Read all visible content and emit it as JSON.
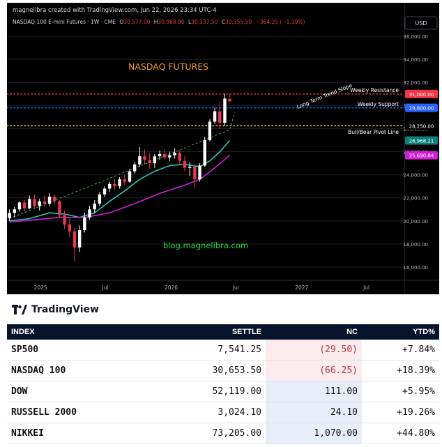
{
  "header": {
    "credit": "magnelibra created with TradingView.com, Jun 22, 2026 23:34 UTC-4",
    "symbol_line": "NASDAQ 100 E-mini Futures · 1W · CME",
    "ohlc": [
      {
        "k": "O",
        "v": "30,577.00"
      },
      {
        "k": "H",
        "v": "30,968.00"
      },
      {
        "k": "L",
        "v": "30,337.50"
      },
      {
        "k": "C",
        "v": "30,355.50"
      }
    ],
    "change": "−364.25 (−1.19%)",
    "currency": "USD"
  },
  "annotations": {
    "title": "NASDAQ FUTURES",
    "watermark": "blog.magnelibra.com",
    "resistance": "Weekly Resistance",
    "support": "Weekly Support",
    "pivot": "Bull/Bear Pivot Line",
    "trend": "Long Term Trend Slope"
  },
  "branding": {
    "name": "TradingView"
  },
  "chart_data": {
    "type": "candlestick",
    "y_ticks": [
      16000,
      18000,
      20000,
      22000,
      24000,
      26000,
      28000,
      30000,
      32000,
      34000,
      36000
    ],
    "y_tick_labels": [
      "16,000.00",
      "18,000.00",
      "20,000.00",
      "22,000.00",
      "24,000.00",
      "26,000.00",
      "28,000.00",
      "30,000.00",
      "32,000.00",
      "34,000.00",
      "36,000.00"
    ],
    "x_labels": [
      {
        "label": "2025",
        "date": "2025-01-01"
      },
      {
        "label": "Jul",
        "date": "2025-07-01"
      },
      {
        "label": "2026",
        "date": "2026-01-01"
      },
      {
        "label": "Jul",
        "date": "2026-07-01"
      },
      {
        "label": "2027",
        "date": "2027-01-01"
      },
      {
        "label": "Jul",
        "date": "2027-07-01"
      }
    ],
    "levels": [
      {
        "value": 31000,
        "label": "31,000.00",
        "color": "#f23645",
        "name": "resistance"
      },
      {
        "value": 29800,
        "label": "29,800.00",
        "color": "#2962ff",
        "name": "support"
      },
      {
        "value": 28250,
        "label": "28,250.00",
        "color": "#e0c21a",
        "name": "pivot"
      }
    ],
    "ma_labels": [
      {
        "value": 26968.21,
        "label": "26,968.21",
        "color": "#26c6b7"
      },
      {
        "value": 25690.84,
        "label": "25,690.84",
        "color": "#d21ed6"
      }
    ],
    "candles": [
      {
        "d": "2024-10-06",
        "o": 20250,
        "h": 21000,
        "l": 20000,
        "c": 20700
      },
      {
        "d": "2024-10-20",
        "o": 20700,
        "h": 21200,
        "l": 20300,
        "c": 21000
      },
      {
        "d": "2024-11-03",
        "o": 21000,
        "h": 21700,
        "l": 20800,
        "c": 21600
      },
      {
        "d": "2024-11-17",
        "o": 21600,
        "h": 21800,
        "l": 20900,
        "c": 21100
      },
      {
        "d": "2024-12-01",
        "o": 21100,
        "h": 22200,
        "l": 21000,
        "c": 21900
      },
      {
        "d": "2024-12-15",
        "o": 21900,
        "h": 22300,
        "l": 21100,
        "c": 21300
      },
      {
        "d": "2024-12-29",
        "o": 21300,
        "h": 21900,
        "l": 20900,
        "c": 21700
      },
      {
        "d": "2025-01-12",
        "o": 21700,
        "h": 22200,
        "l": 21200,
        "c": 21500
      },
      {
        "d": "2025-01-26",
        "o": 21500,
        "h": 22400,
        "l": 21300,
        "c": 22100
      },
      {
        "d": "2025-02-09",
        "o": 22100,
        "h": 22300,
        "l": 21400,
        "c": 21700
      },
      {
        "d": "2025-02-23",
        "o": 21700,
        "h": 21800,
        "l": 20300,
        "c": 20500
      },
      {
        "d": "2025-03-09",
        "o": 20500,
        "h": 20900,
        "l": 19300,
        "c": 19700
      },
      {
        "d": "2025-03-23",
        "o": 19700,
        "h": 20200,
        "l": 18600,
        "c": 19100
      },
      {
        "d": "2025-04-06",
        "o": 19100,
        "h": 19400,
        "l": 16500,
        "c": 17700
      },
      {
        "d": "2025-04-20",
        "o": 17700,
        "h": 19600,
        "l": 17300,
        "c": 19200
      },
      {
        "d": "2025-05-04",
        "o": 19200,
        "h": 20700,
        "l": 19000,
        "c": 20300
      },
      {
        "d": "2025-05-18",
        "o": 20300,
        "h": 21300,
        "l": 20100,
        "c": 21000
      },
      {
        "d": "2025-06-01",
        "o": 21000,
        "h": 21800,
        "l": 20700,
        "c": 21500
      },
      {
        "d": "2025-06-15",
        "o": 21500,
        "h": 22500,
        "l": 21300,
        "c": 22300
      },
      {
        "d": "2025-06-29",
        "o": 22300,
        "h": 23000,
        "l": 22100,
        "c": 22800
      },
      {
        "d": "2025-07-13",
        "o": 22800,
        "h": 23400,
        "l": 22500,
        "c": 23200
      },
      {
        "d": "2025-07-27",
        "o": 23200,
        "h": 23600,
        "l": 22700,
        "c": 23000
      },
      {
        "d": "2025-08-10",
        "o": 23000,
        "h": 23800,
        "l": 22800,
        "c": 23600
      },
      {
        "d": "2025-08-24",
        "o": 23600,
        "h": 24000,
        "l": 23100,
        "c": 23400
      },
      {
        "d": "2025-09-07",
        "o": 23400,
        "h": 24500,
        "l": 23300,
        "c": 24300
      },
      {
        "d": "2025-09-21",
        "o": 24300,
        "h": 25100,
        "l": 24100,
        "c": 24900
      },
      {
        "d": "2025-10-05",
        "o": 24900,
        "h": 26400,
        "l": 24700,
        "c": 25600
      },
      {
        "d": "2025-10-19",
        "o": 25600,
        "h": 26200,
        "l": 24900,
        "c": 25300
      },
      {
        "d": "2025-11-02",
        "o": 25300,
        "h": 25900,
        "l": 24500,
        "c": 25000
      },
      {
        "d": "2025-11-16",
        "o": 25000,
        "h": 25800,
        "l": 24600,
        "c": 25600
      },
      {
        "d": "2025-11-30",
        "o": 25600,
        "h": 26100,
        "l": 25300,
        "c": 25800
      },
      {
        "d": "2025-12-14",
        "o": 25800,
        "h": 26200,
        "l": 25300,
        "c": 25500
      },
      {
        "d": "2025-12-28",
        "o": 25500,
        "h": 26000,
        "l": 25200,
        "c": 25700
      },
      {
        "d": "2026-01-11",
        "o": 25700,
        "h": 26300,
        "l": 25400,
        "c": 25900
      },
      {
        "d": "2026-01-25",
        "o": 25900,
        "h": 26100,
        "l": 24900,
        "c": 25200
      },
      {
        "d": "2026-02-08",
        "o": 25200,
        "h": 25600,
        "l": 24300,
        "c": 24600
      },
      {
        "d": "2026-02-22",
        "o": 24600,
        "h": 25100,
        "l": 23900,
        "c": 24700
      },
      {
        "d": "2026-03-08",
        "o": 24700,
        "h": 24900,
        "l": 22900,
        "c": 23600
      },
      {
        "d": "2026-03-22",
        "o": 23600,
        "h": 25000,
        "l": 23400,
        "c": 24800
      },
      {
        "d": "2026-04-05",
        "o": 24800,
        "h": 27300,
        "l": 24700,
        "c": 27000
      },
      {
        "d": "2026-04-19",
        "o": 27000,
        "h": 28800,
        "l": 26900,
        "c": 28600
      },
      {
        "d": "2026-05-03",
        "o": 28600,
        "h": 29800,
        "l": 28400,
        "c": 29500
      },
      {
        "d": "2026-05-17",
        "o": 29500,
        "h": 30300,
        "l": 28000,
        "c": 28500
      },
      {
        "d": "2026-05-31",
        "o": 28500,
        "h": 31000,
        "l": 28300,
        "c": 30600
      },
      {
        "d": "2026-06-14",
        "o": 30577,
        "h": 30968,
        "l": 30337.5,
        "c": 30355.5
      }
    ],
    "ma_fast": [
      {
        "d": "2024-10-06",
        "v": 20000
      },
      {
        "d": "2024-12-01",
        "v": 20200
      },
      {
        "d": "2025-01-26",
        "v": 20700
      },
      {
        "d": "2025-03-09",
        "v": 20600
      },
      {
        "d": "2025-04-20",
        "v": 20300
      },
      {
        "d": "2025-06-01",
        "v": 20700
      },
      {
        "d": "2025-07-13",
        "v": 21700
      },
      {
        "d": "2025-08-24",
        "v": 22600
      },
      {
        "d": "2025-10-05",
        "v": 23600
      },
      {
        "d": "2025-11-16",
        "v": 24300
      },
      {
        "d": "2025-12-28",
        "v": 24800
      },
      {
        "d": "2026-02-08",
        "v": 24900
      },
      {
        "d": "2026-03-22",
        "v": 24700
      },
      {
        "d": "2026-04-19",
        "v": 25200
      },
      {
        "d": "2026-05-17",
        "v": 26000
      },
      {
        "d": "2026-06-14",
        "v": 26968.21
      }
    ],
    "ma_slow": [
      {
        "d": "2024-10-06",
        "v": 19900
      },
      {
        "d": "2024-12-15",
        "v": 20100
      },
      {
        "d": "2025-02-23",
        "v": 20300
      },
      {
        "d": "2025-05-04",
        "v": 20300
      },
      {
        "d": "2025-07-13",
        "v": 20700
      },
      {
        "d": "2025-09-21",
        "v": 21500
      },
      {
        "d": "2025-12-01",
        "v": 22400
      },
      {
        "d": "2026-02-08",
        "v": 23100
      },
      {
        "d": "2026-03-22",
        "v": 23600
      },
      {
        "d": "2026-05-03",
        "v": 24600
      },
      {
        "d": "2026-06-14",
        "v": 25690.84
      }
    ],
    "trendline": [
      {
        "d": "2024-10-06",
        "v": 20200
      },
      {
        "d": "2026-06-14",
        "v": 27900
      },
      {
        "d": "2026-06-28",
        "v": 29400
      }
    ]
  },
  "table": {
    "headers": [
      "INDEX",
      "SETTLE",
      "NC",
      "YTD%"
    ],
    "rows": [
      {
        "name": "SP500",
        "settle": "7,541.25",
        "nc": "(29.50)",
        "ytd": "+7.84%",
        "neg": true
      },
      {
        "name": "NASDAQ 100",
        "settle": "30,653.50",
        "nc": "(66.25)",
        "ytd": "+18.39%",
        "neg": true
      },
      {
        "name": "DOW",
        "settle": "52,119.00",
        "nc": "111.00",
        "ytd": "+5.95%",
        "neg": false
      },
      {
        "name": "RUSSELL 2000",
        "settle": "3,024.10",
        "nc": "24.10",
        "ytd": "+19.26%",
        "neg": false
      },
      {
        "name": "NIKKEI",
        "settle": "73,205.00",
        "nc": "1,070.00",
        "ytd": "+44.80%",
        "neg": false
      }
    ]
  }
}
